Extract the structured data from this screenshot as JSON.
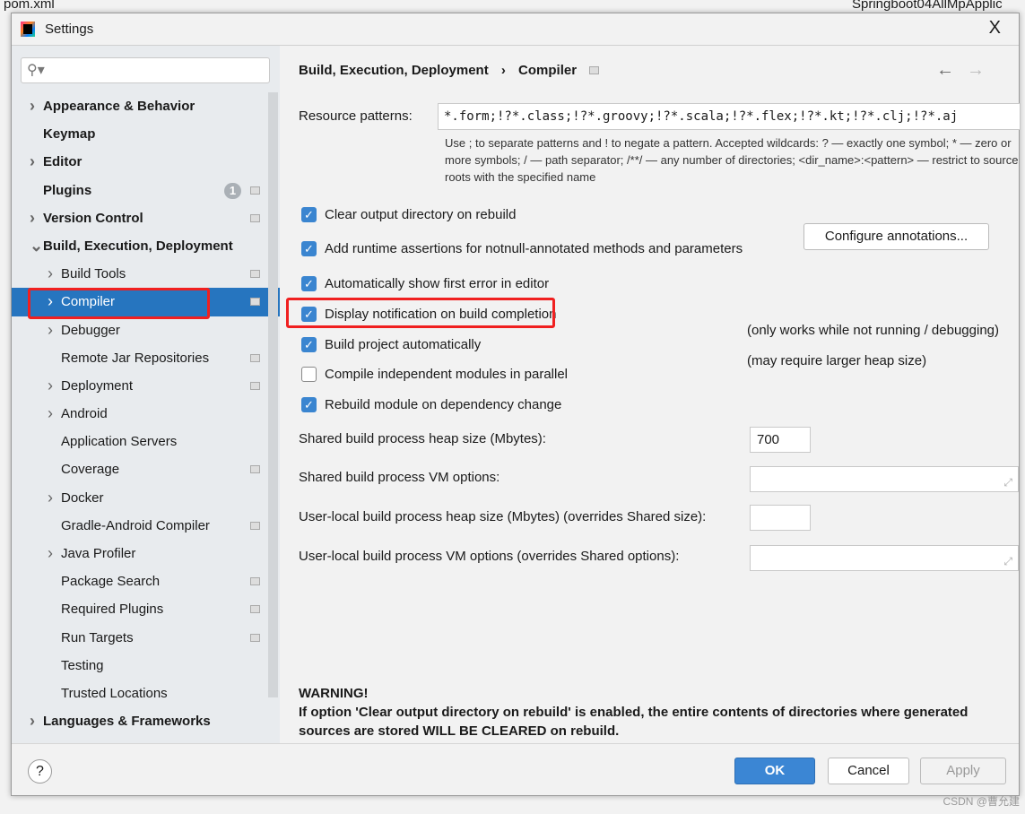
{
  "ide": {
    "file_tab": "pom.xml",
    "run_config": "Springboot04AllMpApplic"
  },
  "dialog": {
    "title": "Settings",
    "close": "X"
  },
  "search": {
    "placeholder": "",
    "icon": "search-icon"
  },
  "tree": [
    {
      "label": "Appearance & Behavior",
      "level": 0,
      "bold": true,
      "chevron": "right"
    },
    {
      "label": "Keymap",
      "level": 0,
      "bold": true
    },
    {
      "label": "Editor",
      "level": 0,
      "bold": true,
      "chevron": "right"
    },
    {
      "label": "Plugins",
      "level": 0,
      "bold": true,
      "badge": "1",
      "page_icon": true
    },
    {
      "label": "Version Control",
      "level": 0,
      "bold": true,
      "chevron": "right",
      "page_icon": true
    },
    {
      "label": "Build, Execution, Deployment",
      "level": 0,
      "bold": true,
      "chevron": "down"
    },
    {
      "label": "Build Tools",
      "level": 1,
      "chevron": "right",
      "page_icon": true
    },
    {
      "label": "Compiler",
      "level": 1,
      "chevron": "right",
      "page_icon": true,
      "selected": true
    },
    {
      "label": "Debugger",
      "level": 1,
      "chevron": "right"
    },
    {
      "label": "Remote Jar Repositories",
      "level": 1,
      "page_icon": true
    },
    {
      "label": "Deployment",
      "level": 1,
      "chevron": "right",
      "page_icon": true
    },
    {
      "label": "Android",
      "level": 1,
      "chevron": "right"
    },
    {
      "label": "Application Servers",
      "level": 1
    },
    {
      "label": "Coverage",
      "level": 1,
      "page_icon": true
    },
    {
      "label": "Docker",
      "level": 1,
      "chevron": "right"
    },
    {
      "label": "Gradle-Android Compiler",
      "level": 1,
      "page_icon": true
    },
    {
      "label": "Java Profiler",
      "level": 1,
      "chevron": "right"
    },
    {
      "label": "Package Search",
      "level": 1,
      "page_icon": true
    },
    {
      "label": "Required Plugins",
      "level": 1,
      "page_icon": true
    },
    {
      "label": "Run Targets",
      "level": 1,
      "page_icon": true
    },
    {
      "label": "Testing",
      "level": 1
    },
    {
      "label": "Trusted Locations",
      "level": 1
    },
    {
      "label": "Languages & Frameworks",
      "level": 0,
      "bold": true,
      "chevron": "right"
    }
  ],
  "breadcrumb": {
    "parent": "Build, Execution, Deployment",
    "sep": "›",
    "current": "Compiler"
  },
  "nav": {
    "back": "←",
    "forward": "→"
  },
  "resource": {
    "label": "Resource patterns:",
    "value": "*.form;!?*.class;!?*.groovy;!?*.scala;!?*.flex;!?*.kt;!?*.clj;!?*.aj",
    "hint": "Use ; to separate patterns and ! to negate a pattern. Accepted wildcards: ? — exactly one symbol; * — zero or more symbols; / — path separator; /**/ — any number of directories; <dir_name>:<pattern> — restrict to source roots with the specified name"
  },
  "options": [
    {
      "label": "Clear output directory on rebuild",
      "checked": true
    },
    {
      "label": "Add runtime assertions for notnull-annotated methods and parameters",
      "checked": true
    },
    {
      "label": "Automatically show first error in editor",
      "checked": true
    },
    {
      "label": "Display notification on build completion",
      "checked": true
    },
    {
      "label": "Build project automatically",
      "checked": true
    },
    {
      "label": "Compile independent modules in parallel",
      "checked": false
    },
    {
      "label": "Rebuild module on dependency change",
      "checked": true
    }
  ],
  "configure_button": "Configure annotations...",
  "notes": {
    "auto": "(only works while not running / debugging)",
    "parallel": "(may require larger heap size)"
  },
  "fields": [
    {
      "label": "Shared build process heap size (Mbytes):",
      "value": "700"
    },
    {
      "label": "Shared build process VM options:",
      "value": ""
    },
    {
      "label": "User-local build process heap size (Mbytes) (overrides Shared size):",
      "value": ""
    },
    {
      "label": "User-local build process VM options (overrides Shared options):",
      "value": ""
    }
  ],
  "warning": {
    "title": "WARNING!",
    "text": "If option 'Clear output directory on rebuild' is enabled, the entire contents of directories where generated sources are stored WILL BE CLEARED on rebuild."
  },
  "footer": {
    "help": "?",
    "ok": "OK",
    "cancel": "Cancel",
    "apply": "Apply"
  },
  "watermark": "CSDN @曹允建",
  "colors": {
    "selection": "#2675bf",
    "accent": "#3b86d4",
    "annotation": "#f02020"
  }
}
